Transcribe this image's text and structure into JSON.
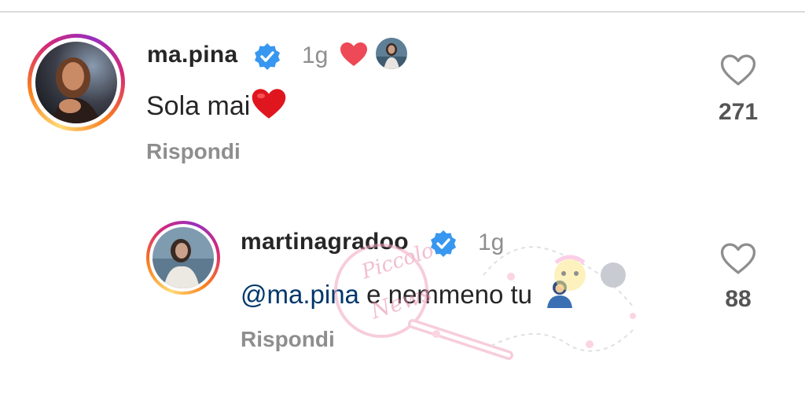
{
  "comment": {
    "username": "ma.pina",
    "time": "1g",
    "text": "Sola mai",
    "reply_label": "Rispondi",
    "like_count": "271",
    "liked_by_author_icon": "heart-red-icon"
  },
  "reply": {
    "username": "martinagradoo",
    "time": "1g",
    "mention": "@ma.pina",
    "text": " e nemmeno tu",
    "reply_label": "Rispondi",
    "like_count": "88"
  },
  "watermark": {
    "text_top": "Piccolo",
    "text_bottom": "News"
  },
  "colors": {
    "verified_blue": "#3897f0",
    "heart_red": "#ed4956",
    "muted": "#8e8e8e",
    "mention": "#00376b"
  }
}
